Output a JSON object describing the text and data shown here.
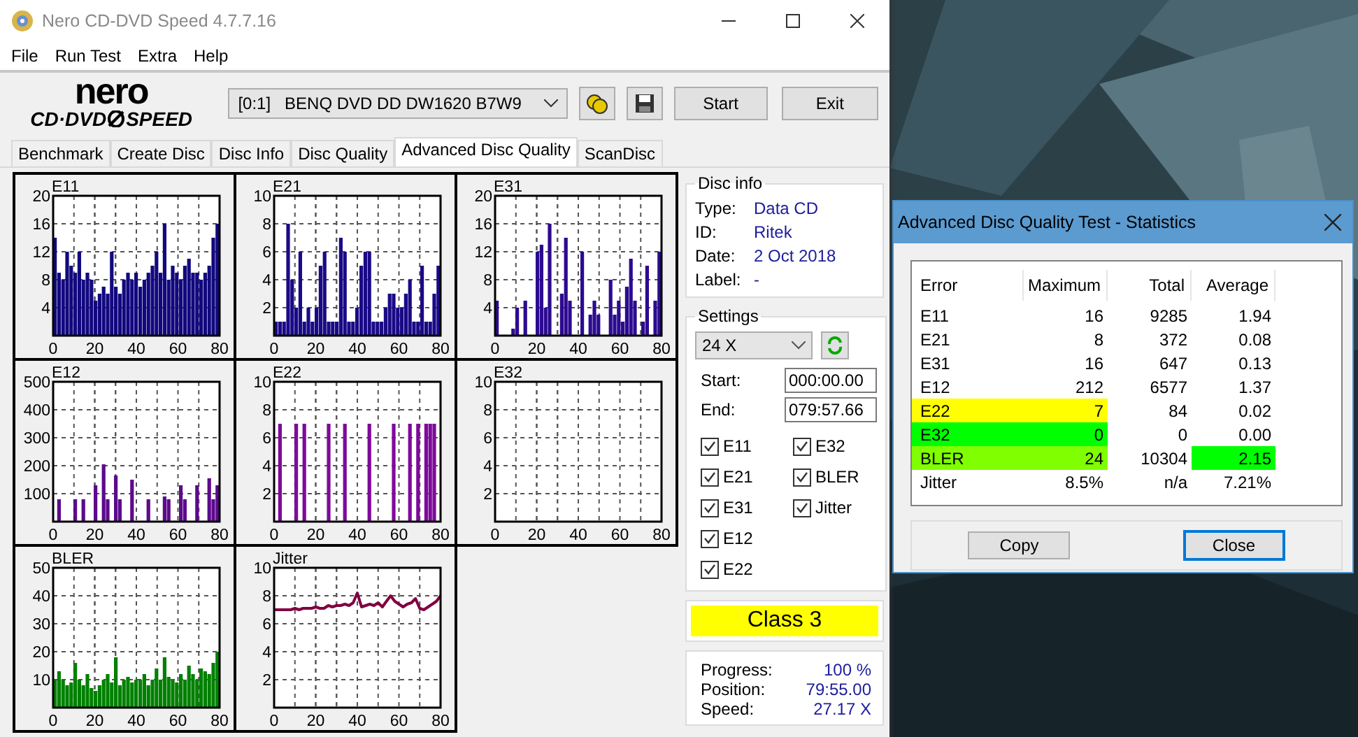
{
  "window": {
    "title": "Nero CD-DVD Speed 4.7.7.16"
  },
  "menu": [
    "File",
    "Run Test",
    "Extra",
    "Help"
  ],
  "toolbar": {
    "logo_top": "nero",
    "logo_left": "CD·DVD",
    "logo_right": "SPEED",
    "drive": "[0:1]   BENQ DVD DD DW1620 B7W9",
    "buttons": [
      "Start",
      "Exit"
    ]
  },
  "tabs": [
    {
      "label": "Benchmark",
      "selected": false
    },
    {
      "label": "Create Disc",
      "selected": false
    },
    {
      "label": "Disc Info",
      "selected": false
    },
    {
      "label": "Disc Quality",
      "selected": false
    },
    {
      "label": "Advanced Disc Quality",
      "selected": true
    },
    {
      "label": "ScanDisc",
      "selected": false
    }
  ],
  "charts": [
    {
      "chart_data": {
        "type": "bar",
        "grid": true,
        "x": [
          0,
          2,
          4,
          6,
          8,
          10,
          12,
          14,
          16,
          18,
          20,
          22,
          24,
          26,
          28,
          30,
          32,
          34,
          36,
          38,
          40,
          42,
          44,
          46,
          48,
          50,
          52,
          54,
          56,
          58,
          60,
          62,
          64,
          66,
          68,
          70,
          72,
          74,
          76,
          78,
          80
        ],
        "series": [
          {
            "name": "E11",
            "color": "#12087e",
            "values": [
              14,
              9,
              8,
              12,
              10,
              9,
              12,
              8,
              9,
              8,
              5,
              6,
              7,
              6,
              12,
              7,
              6,
              8,
              9,
              8,
              9,
              7,
              8,
              9,
              10,
              12,
              9,
              16,
              8,
              10,
              9,
              8,
              10,
              11,
              9,
              9,
              8,
              9,
              10,
              14,
              16
            ]
          }
        ],
        "xlim": [
          0,
          80
        ],
        "ylim": [
          0,
          20
        ],
        "xticks": [
          0,
          20,
          40,
          60,
          80
        ],
        "yticks": [
          4,
          8,
          12,
          16,
          20
        ]
      }
    },
    {
      "chart_data": {
        "type": "bar",
        "grid": true,
        "x": [
          0,
          2,
          4,
          6,
          8,
          10,
          12,
          14,
          16,
          18,
          20,
          22,
          24,
          26,
          28,
          30,
          32,
          34,
          36,
          38,
          40,
          42,
          44,
          46,
          48,
          50,
          52,
          54,
          56,
          58,
          60,
          62,
          64,
          66,
          68,
          70,
          72,
          74,
          76,
          78,
          80
        ],
        "series": [
          {
            "name": "E21",
            "color": "#1a0a86",
            "values": [
              1,
              1,
              1,
              8,
              4,
              2,
              6,
              1,
              2,
              1,
              2,
              5,
              6,
              1,
              1,
              1,
              7,
              6,
              1,
              1,
              2,
              5,
              6,
              6,
              1,
              1,
              1,
              2,
              3,
              3,
              2,
              2,
              3,
              4,
              1,
              1,
              5,
              1,
              1,
              3,
              5
            ]
          }
        ],
        "xlim": [
          0,
          80
        ],
        "ylim": [
          0,
          10
        ],
        "xticks": [
          0,
          20,
          40,
          60,
          80
        ],
        "yticks": [
          2,
          4,
          6,
          8,
          10
        ]
      }
    },
    {
      "chart_data": {
        "type": "bar",
        "grid": true,
        "x": [
          0,
          2,
          4,
          6,
          8,
          10,
          12,
          14,
          16,
          18,
          20,
          22,
          24,
          26,
          28,
          30,
          32,
          34,
          36,
          38,
          40,
          42,
          44,
          46,
          48,
          50,
          52,
          54,
          56,
          58,
          60,
          62,
          64,
          66,
          68,
          70,
          72,
          74,
          76,
          78,
          80
        ],
        "series": [
          {
            "name": "E31",
            "color": "#2c0a90",
            "values": [
              5,
              0,
              0,
              0,
              1,
              4,
              0,
              5,
              0,
              0,
              12,
              13,
              4,
              16,
              0,
              0,
              6,
              14,
              5,
              0,
              0,
              12,
              0,
              3,
              5,
              3,
              0,
              0,
              8,
              3,
              5,
              2,
              7,
              11,
              5,
              0,
              2,
              10,
              0,
              5,
              12
            ]
          }
        ],
        "xlim": [
          0,
          80
        ],
        "ylim": [
          0,
          20
        ],
        "xticks": [
          0,
          20,
          40,
          60,
          80
        ],
        "yticks": [
          4,
          8,
          12,
          16,
          20
        ]
      }
    },
    {
      "chart_data": {
        "type": "bar",
        "grid": true,
        "x": [
          0,
          2,
          4,
          6,
          8,
          10,
          12,
          14,
          16,
          18,
          20,
          22,
          24,
          26,
          28,
          30,
          32,
          34,
          36,
          38,
          40,
          42,
          44,
          46,
          48,
          50,
          52,
          54,
          56,
          58,
          60,
          62,
          64,
          66,
          68,
          70,
          72,
          74,
          76,
          78,
          80
        ],
        "series": [
          {
            "name": "E12",
            "color": "#5c0a8c",
            "values": [
              0,
              80,
              0,
              0,
              0,
              80,
              0,
              80,
              0,
              0,
              130,
              0,
              205,
              80,
              0,
              165,
              80,
              0,
              0,
              150,
              0,
              0,
              0,
              80,
              0,
              0,
              0,
              90,
              80,
              0,
              0,
              130,
              80,
              0,
              0,
              130,
              0,
              0,
              155,
              80,
              130
            ]
          }
        ],
        "xlim": [
          0,
          80
        ],
        "ylim": [
          0,
          500
        ],
        "xticks": [
          0,
          20,
          40,
          60,
          80
        ],
        "yticks": [
          100,
          200,
          300,
          400,
          500
        ]
      }
    },
    {
      "chart_data": {
        "type": "bar",
        "grid": true,
        "x": [
          0,
          2,
          4,
          6,
          8,
          10,
          12,
          14,
          16,
          18,
          20,
          22,
          24,
          26,
          28,
          30,
          32,
          34,
          36,
          38,
          40,
          42,
          44,
          46,
          48,
          50,
          52,
          54,
          56,
          58,
          60,
          62,
          64,
          66,
          68,
          70,
          72,
          74,
          76,
          78,
          80
        ],
        "series": [
          {
            "name": "E22",
            "color": "#7e0a9a",
            "values": [
              0,
              7,
              0,
              0,
              0,
              7,
              0,
              7,
              0,
              0,
              0,
              0,
              0,
              7,
              0,
              0,
              0,
              7,
              0,
              0,
              0,
              0,
              0,
              7,
              0,
              0,
              0,
              0,
              0,
              7,
              0,
              0,
              0,
              7,
              0,
              7,
              0,
              7,
              7,
              7,
              0
            ]
          }
        ],
        "xlim": [
          0,
          80
        ],
        "ylim": [
          0,
          10
        ],
        "xticks": [
          0,
          20,
          40,
          60,
          80
        ],
        "yticks": [
          2,
          4,
          6,
          8,
          10
        ]
      }
    },
    {
      "chart_data": {
        "type": "bar",
        "grid": true,
        "x": [
          0,
          2,
          4,
          6,
          8,
          10,
          12,
          14,
          16,
          18,
          20,
          22,
          24,
          26,
          28,
          30,
          32,
          34,
          36,
          38,
          40,
          42,
          44,
          46,
          48,
          50,
          52,
          54,
          56,
          58,
          60,
          62,
          64,
          66,
          68,
          70,
          72,
          74,
          76,
          78,
          80
        ],
        "series": [
          {
            "name": "E32",
            "values": [
              0,
              0,
              0,
              0,
              0,
              0,
              0,
              0,
              0,
              0,
              0,
              0,
              0,
              0,
              0,
              0,
              0,
              0,
              0,
              0,
              0,
              0,
              0,
              0,
              0,
              0,
              0,
              0,
              0,
              0,
              0,
              0,
              0,
              0,
              0,
              0,
              0,
              0,
              0,
              0,
              0
            ]
          }
        ],
        "xlim": [
          0,
          80
        ],
        "ylim": [
          0,
          10
        ],
        "xticks": [
          0,
          20,
          40,
          60,
          80
        ],
        "yticks": [
          2,
          4,
          6,
          8,
          10
        ]
      }
    },
    {
      "chart_data": {
        "type": "bar",
        "grid": true,
        "x": [
          0,
          2,
          4,
          6,
          8,
          10,
          12,
          14,
          16,
          18,
          20,
          22,
          24,
          26,
          28,
          30,
          32,
          34,
          36,
          38,
          40,
          42,
          44,
          46,
          48,
          50,
          52,
          54,
          56,
          58,
          60,
          62,
          64,
          66,
          68,
          70,
          72,
          74,
          76,
          78,
          80
        ],
        "series": [
          {
            "name": "BLER",
            "color": "#008000",
            "values": [
              10,
              13,
              10,
              8,
              9,
              16,
              10,
              8,
              12,
              7,
              6,
              8,
              10,
              12,
              9,
              18,
              8,
              10,
              11,
              9,
              10,
              10,
              12,
              8,
              10,
              14,
              10,
              18,
              11,
              10,
              9,
              12,
              10,
              15,
              12,
              10,
              14,
              13,
              12,
              16,
              20
            ]
          }
        ],
        "xlim": [
          0,
          80
        ],
        "ylim": [
          0,
          50
        ],
        "xticks": [
          0,
          20,
          40,
          60,
          80
        ],
        "yticks": [
          10,
          20,
          30,
          40,
          50
        ]
      }
    },
    {
      "chart_data": {
        "type": "line",
        "grid": true,
        "x": [
          0,
          2,
          4,
          6,
          8,
          10,
          12,
          14,
          16,
          18,
          20,
          22,
          24,
          26,
          28,
          30,
          32,
          34,
          36,
          38,
          40,
          42,
          44,
          46,
          48,
          50,
          52,
          54,
          56,
          58,
          60,
          62,
          64,
          66,
          68,
          70,
          72,
          74,
          76,
          78,
          80
        ],
        "series": [
          {
            "name": "Jitter",
            "color": "#800040",
            "values": [
              7.0,
              7.0,
              7.0,
              7.0,
              7.0,
              7.1,
              7.0,
              7.1,
              7.1,
              7.1,
              7.2,
              7.1,
              7.1,
              7.3,
              7.2,
              7.3,
              7.3,
              7.4,
              7.3,
              7.5,
              8.2,
              7.2,
              7.3,
              7.4,
              7.3,
              7.5,
              7.2,
              7.6,
              8.0,
              7.6,
              7.4,
              7.2,
              7.4,
              7.5,
              7.8,
              7.1,
              7.0,
              7.2,
              7.4,
              7.6,
              8.0
            ]
          }
        ],
        "xlim": [
          0,
          80
        ],
        "ylim": [
          0,
          10
        ],
        "xticks": [
          0,
          20,
          40,
          60,
          80
        ],
        "yticks": [
          2,
          4,
          6,
          8,
          10
        ]
      }
    }
  ],
  "disc_info": {
    "title": "Disc info",
    "rows": [
      {
        "label": "Type:",
        "value": "Data CD"
      },
      {
        "label": "ID:",
        "value": "Ritek"
      },
      {
        "label": "Date:",
        "value": "2 Oct 2018"
      },
      {
        "label": "Label:",
        "value": "-"
      }
    ]
  },
  "settings": {
    "title": "Settings",
    "speed": "24 X",
    "start_label": "Start:",
    "start": "000:00.00",
    "end_label": "End:",
    "end": "079:57.66",
    "checks": [
      {
        "label": "E11",
        "checked": true
      },
      {
        "label": "E21",
        "checked": true
      },
      {
        "label": "E31",
        "checked": true
      },
      {
        "label": "E12",
        "checked": true
      },
      {
        "label": "E22",
        "checked": true
      },
      {
        "label": "E32",
        "checked": true
      },
      {
        "label": "BLER",
        "checked": true
      },
      {
        "label": "Jitter",
        "checked": true
      }
    ]
  },
  "result": "Class 3",
  "progress": [
    {
      "label": "Progress:",
      "value": "100 %"
    },
    {
      "label": "Position:",
      "value": "79:55.00"
    },
    {
      "label": "Speed:",
      "value": "27.17 X"
    }
  ],
  "dialog": {
    "title": "Advanced Disc Quality Test - Statistics",
    "columns": [
      "Error",
      "Maximum",
      "Total",
      "Average"
    ],
    "rows": [
      {
        "cells": [
          {
            "text": "E11"
          },
          {
            "text": "16"
          },
          {
            "text": "9285"
          },
          {
            "text": "1.94"
          }
        ]
      },
      {
        "cells": [
          {
            "text": "E21"
          },
          {
            "text": "8"
          },
          {
            "text": "372"
          },
          {
            "text": "0.08"
          }
        ]
      },
      {
        "cells": [
          {
            "text": "E31"
          },
          {
            "text": "16"
          },
          {
            "text": "647"
          },
          {
            "text": "0.13"
          }
        ]
      },
      {
        "cells": [
          {
            "text": "E12"
          },
          {
            "text": "212"
          },
          {
            "text": "6577"
          },
          {
            "text": "1.37"
          }
        ]
      },
      {
        "cells": [
          {
            "text": "E22",
            "color": "#ffff00"
          },
          {
            "text": "7",
            "color": "#ffff00"
          },
          {
            "text": "84"
          },
          {
            "text": "0.02"
          }
        ]
      },
      {
        "cells": [
          {
            "text": "E32",
            "color": "#00ff00"
          },
          {
            "text": "0",
            "color": "#00ff00"
          },
          {
            "text": "0"
          },
          {
            "text": "0.00"
          }
        ]
      },
      {
        "cells": [
          {
            "text": "BLER",
            "color": "#80ff00"
          },
          {
            "text": "24",
            "color": "#80ff00"
          },
          {
            "text": "10304"
          },
          {
            "text": "2.15",
            "color": "#00ff00"
          }
        ]
      },
      {
        "cells": [
          {
            "text": "Jitter"
          },
          {
            "text": "8.5%"
          },
          {
            "text": "n/a"
          },
          {
            "text": "7.21%"
          }
        ]
      }
    ],
    "buttons": [
      "Copy",
      "Close"
    ]
  }
}
